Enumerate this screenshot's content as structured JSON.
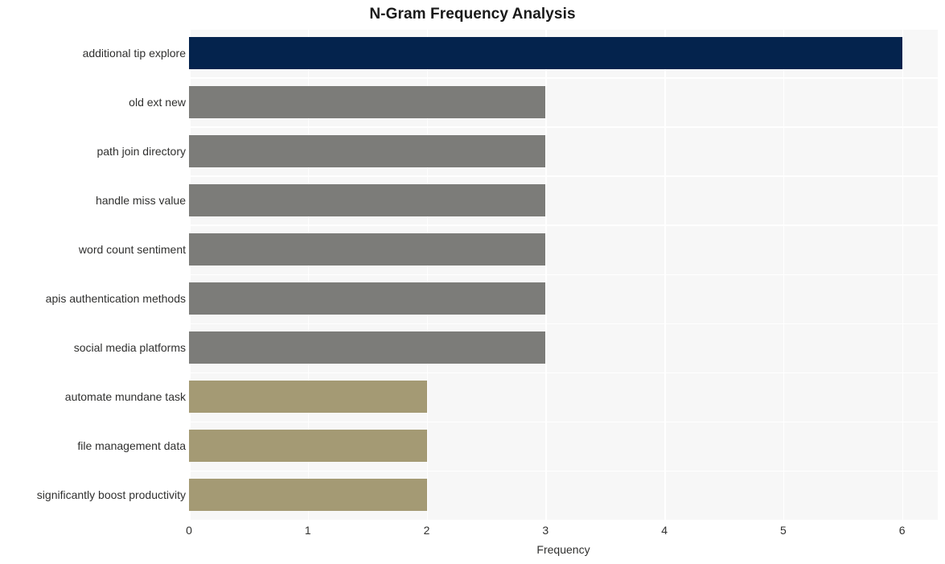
{
  "chart_data": {
    "type": "bar",
    "orientation": "horizontal",
    "title": "N-Gram Frequency Analysis",
    "xlabel": "Frequency",
    "ylabel": "",
    "xlim": [
      0,
      6.3
    ],
    "xticks": [
      "0",
      "1",
      "2",
      "3",
      "4",
      "5",
      "6"
    ],
    "xtick_values": [
      0,
      1,
      2,
      3,
      4,
      5,
      6
    ],
    "grid": true,
    "grid_color": "#ffffff",
    "plot_background": "#f7f7f7",
    "legend": null,
    "categories": [
      "additional tip explore",
      "old ext new",
      "path join directory",
      "handle miss value",
      "word count sentiment",
      "apis authentication methods",
      "social media platforms",
      "automate mundane task",
      "file management data",
      "significantly boost productivity"
    ],
    "values": [
      6,
      3,
      3,
      3,
      3,
      3,
      3,
      2,
      2,
      2
    ],
    "bar_colors": [
      "#04234d",
      "#7c7c79",
      "#7c7c79",
      "#7c7c79",
      "#7c7c79",
      "#7c7c79",
      "#7c7c79",
      "#a49a74",
      "#a49a74",
      "#a49a74"
    ]
  }
}
